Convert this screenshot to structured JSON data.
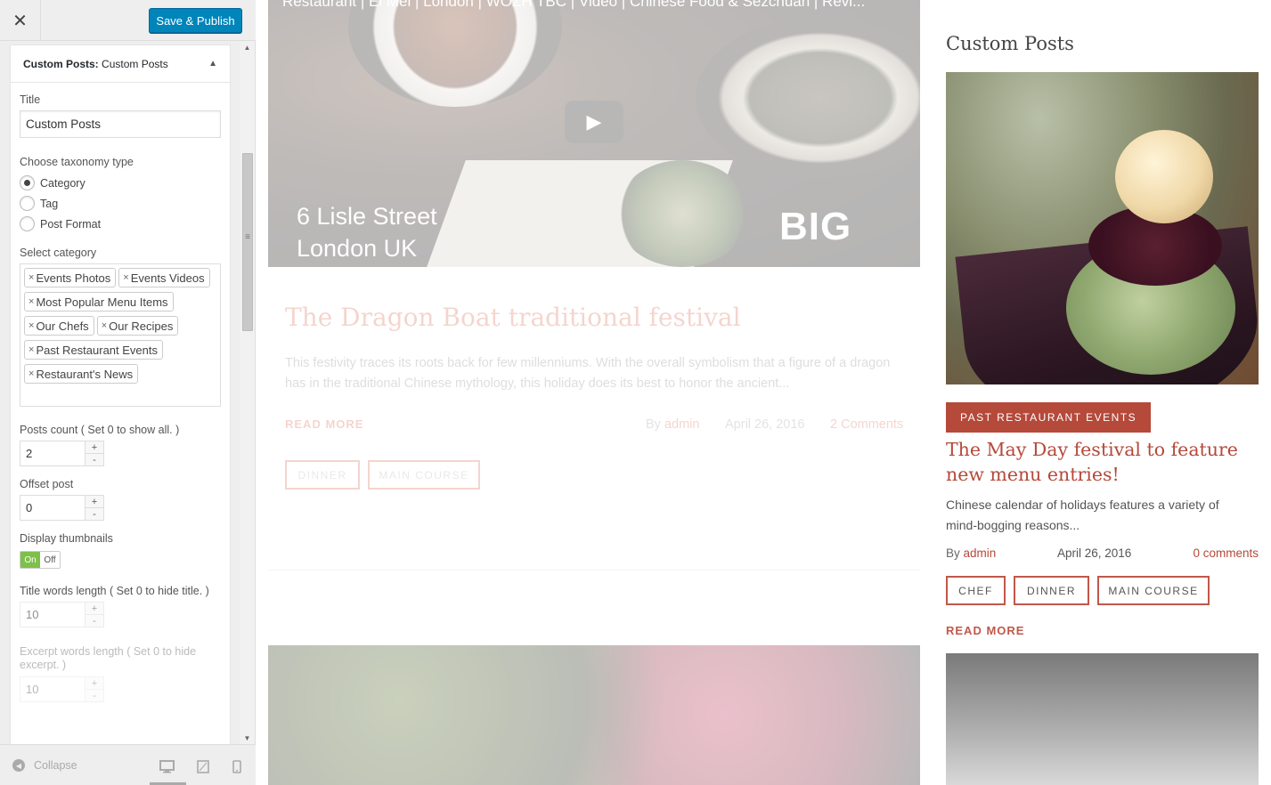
{
  "panel": {
    "close_label": "✕",
    "publish_label": "Save & Publish",
    "widget_header": {
      "bold": "Custom Posts:",
      "rest": " Custom Posts",
      "arrow": "▲"
    },
    "title": {
      "label": "Title",
      "value": "Custom Posts"
    },
    "taxonomy": {
      "label": "Choose taxonomy type",
      "options": [
        "Category",
        "Tag",
        "Post Format"
      ],
      "selected": "Category"
    },
    "category": {
      "label": "Select category",
      "chips": [
        "Events Photos",
        "Events Videos",
        "Most Popular Menu Items",
        "Our Chefs",
        "Our Recipes",
        "Past Restaurant Events",
        "Restaurant's News"
      ],
      "remove_symbol": "×"
    },
    "posts_count": {
      "label": "Posts count ( Set 0 to show all. )",
      "value": "2"
    },
    "offset": {
      "label": "Offset post",
      "value": "0"
    },
    "thumbnails": {
      "label": "Display thumbnails",
      "on": "On",
      "off": "Off"
    },
    "title_words": {
      "label": "Title words length ( Set 0 to hide title. )",
      "value": "10"
    },
    "excerpt_words": {
      "label": "Excerpt words length ( Set 0 to hide excerpt. )",
      "value": "10"
    },
    "stepper": {
      "plus": "+",
      "minus": "-"
    },
    "footer": {
      "collapse_label": "Collapse"
    }
  },
  "preview": {
    "video": {
      "title": "Restaurant | El Mei | London | WOZH TBC | Video | Chinese Food & Sezchuan | Revi...",
      "address_line1": "6 Lisle Street",
      "address_line2": "London UK",
      "logo": "BIG"
    },
    "post": {
      "title": "The Dragon Boat traditional festival",
      "excerpt": "This festivity traces its roots back for few millenniums. With the overall symbolism that a figure of a dragon has in the traditional Chinese mythology, this holiday does its best to honor the ancient...",
      "read_more": "READ MORE",
      "by": "By",
      "author": "admin",
      "date": "April 26, 2016",
      "comments": "2 Comments",
      "tags": [
        "DINNER",
        "MAIN COURSE"
      ]
    },
    "sidebar": {
      "widget_title": "Custom Posts",
      "badge": "PAST RESTAURANT EVENTS",
      "post_title": "The May Day festival to feature new menu entries!",
      "excerpt": "Chinese calendar of holidays features a variety of mind-bogging reasons...",
      "by": "By",
      "author": "admin",
      "date": "April 26, 2016",
      "comments": "0 comments",
      "tags": [
        "CHEF",
        "DINNER",
        "MAIN COURSE"
      ],
      "read_more": "READ MORE"
    }
  },
  "colors": {
    "accent": "#b5493a",
    "publish": "#0085ba",
    "toggle_on": "#7ec04a"
  }
}
